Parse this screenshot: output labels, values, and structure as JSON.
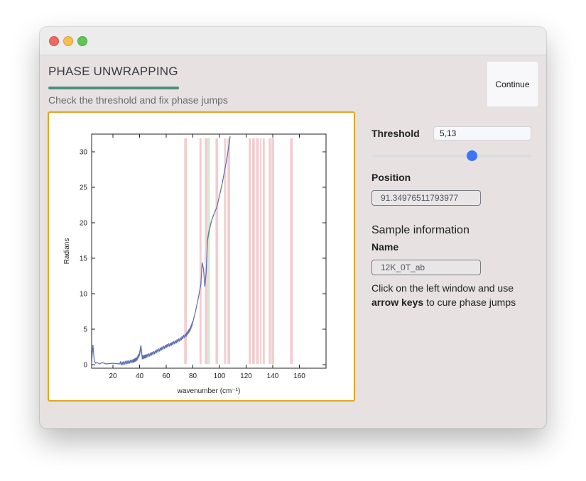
{
  "page": {
    "title": "PHASE UNWRAPPING",
    "subtitle": "Check the threshold and fix phase jumps",
    "continue_label": "Continue"
  },
  "controls": {
    "threshold_label": "Threshold",
    "threshold_value": "5,13",
    "slider_fraction": 0.63,
    "position_label": "Position",
    "position_value": "91.34976511793977"
  },
  "sample": {
    "heading": "Sample information",
    "name_label": "Name",
    "name_value": "12K_0T_ab",
    "instructions_before": "Click on the left window and use",
    "instructions_bold": "arrow keys",
    "instructions_after": "to cure phase jumps"
  },
  "colors": {
    "accent_rule": "#4d8f7f",
    "plot_border": "#e0a624",
    "slider_knob": "#3b74f6",
    "curve": "#5b6db0",
    "curve_fixed": "#4d8f7f",
    "band": "#e7a2a8",
    "band_selected": "#cfe3c8"
  },
  "chart_data": {
    "type": "line",
    "xlabel": "wavenumber (cm⁻¹)",
    "ylabel": "Radians",
    "xlim": [
      4,
      180
    ],
    "ylim": [
      -0.5,
      32.5
    ],
    "xticks": [
      20,
      40,
      60,
      80,
      100,
      120,
      140,
      160
    ],
    "yticks": [
      0,
      5,
      10,
      15,
      20,
      25,
      30
    ],
    "series": [
      {
        "x": [
          4,
          5,
          6,
          7,
          8,
          10,
          12,
          15,
          20,
          25,
          30,
          35,
          38,
          40,
          41,
          42,
          45,
          50,
          55,
          60,
          65,
          70,
          75,
          78,
          80,
          82,
          84,
          86,
          87,
          88,
          89,
          90,
          91,
          92,
          93,
          94,
          96,
          98,
          100,
          102,
          104,
          106,
          108
        ],
        "y": [
          0.5,
          2.8,
          0.5,
          0.2,
          0.3,
          0.1,
          0.3,
          0.1,
          0.2,
          0.1,
          0.3,
          0.5,
          0.8,
          1.5,
          2.6,
          1.0,
          1.2,
          1.6,
          2.1,
          2.6,
          3.0,
          3.5,
          4.2,
          5.0,
          6.0,
          7.5,
          9.3,
          11.3,
          14.4,
          13.5,
          11.0,
          13.0,
          17.5,
          18.7,
          19.5,
          20.3,
          21.3,
          22.2,
          23.8,
          25.5,
          27.5,
          29.5,
          32.2
        ]
      }
    ],
    "bands": [
      [
        73.5,
        75.5
      ],
      [
        85,
        86.5
      ],
      [
        89,
        91
      ],
      [
        97,
        99
      ],
      [
        103.5,
        105
      ],
      [
        106,
        108
      ],
      [
        122,
        123.5
      ],
      [
        124.5,
        126.5
      ],
      [
        127.5,
        129.5
      ],
      [
        130.5,
        131.5
      ],
      [
        132.5,
        134
      ],
      [
        137,
        138.5
      ],
      [
        139,
        141
      ],
      [
        153,
        155
      ]
    ],
    "selected_band": [
      91,
      93
    ]
  }
}
